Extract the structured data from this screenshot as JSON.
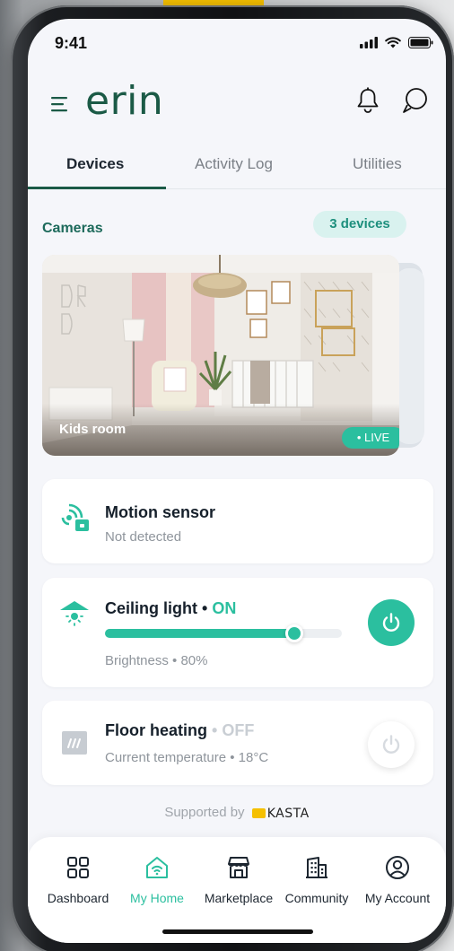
{
  "status_bar": {
    "time": "9:41"
  },
  "header": {
    "logo": "erin"
  },
  "tabs": [
    {
      "label": "Devices",
      "active": true
    },
    {
      "label": "Activity Log",
      "active": false
    },
    {
      "label": "Utilities",
      "active": false
    }
  ],
  "cameras": {
    "title": "Cameras",
    "count_badge": "3 devices",
    "items": [
      {
        "label": "Kids room",
        "status": "• LIVE"
      }
    ]
  },
  "devices": [
    {
      "name": "Motion sensor",
      "subtitle": "Not detected",
      "icon": "motion-sensor-icon"
    },
    {
      "name": "Ceiling light",
      "state": "ON",
      "subtitle": "Brightness • 80%",
      "brightness": 0.8,
      "icon": "ceiling-light-icon",
      "power": "on"
    },
    {
      "name": "Floor heating",
      "state": "OFF",
      "subtitle": "Current temperature • 18°C",
      "icon": "floor-heating-icon",
      "power": "off"
    }
  ],
  "footer": {
    "supported_by": "Supported by",
    "brand": "KASTA"
  },
  "bottom_nav": [
    {
      "label": "Dashboard",
      "icon": "grid-icon",
      "active": false
    },
    {
      "label": "My Home",
      "icon": "home-wifi-icon",
      "active": true
    },
    {
      "label": "Marketplace",
      "icon": "store-icon",
      "active": false
    },
    {
      "label": "Community",
      "icon": "building-icon",
      "active": false
    },
    {
      "label": "My Account",
      "icon": "user-circle-icon",
      "active": false
    }
  ],
  "colors": {
    "brand": "#1b5a46",
    "accent": "#2bbf9f",
    "badge_bg": "#d9f2ef"
  }
}
